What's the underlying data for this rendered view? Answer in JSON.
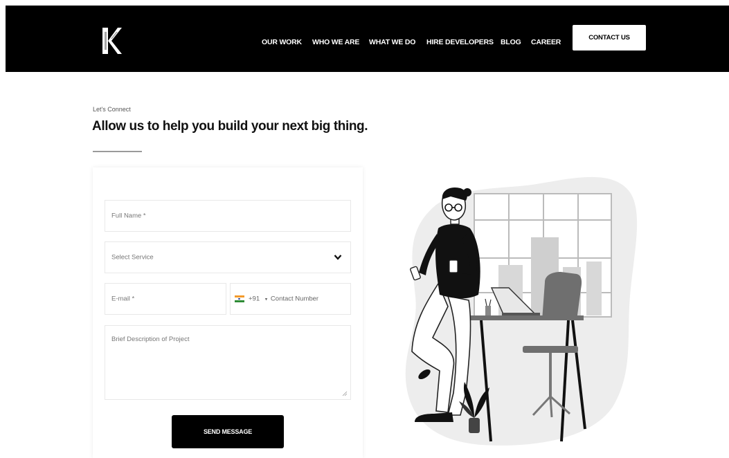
{
  "nav": {
    "items": [
      {
        "label": "OUR WORK"
      },
      {
        "label": "WHO WE ARE"
      },
      {
        "label": "WHAT WE DO"
      },
      {
        "label": "HIRE DEVELOPERS"
      },
      {
        "label": "BLOG"
      },
      {
        "label": "CAREER"
      }
    ],
    "cta_label": "CONTACT US"
  },
  "hero": {
    "eyebrow": "Let's Connect",
    "headline": "Allow us to help you build your next big thing."
  },
  "form": {
    "full_name_placeholder": "Full Name *",
    "service_placeholder": "Select Service",
    "email_placeholder": "E-mail *",
    "country_code": "+91",
    "contact_placeholder": "Contact Number",
    "description_placeholder": "Brief Description of Project",
    "submit_label": "SEND MESSAGE"
  },
  "icons": {
    "logo": "k-logo-icon",
    "dropdown": "chevron-down-icon",
    "flag": "india-flag-icon",
    "illustration": "office-worker-illustration"
  },
  "colors": {
    "header_bg": "#000000",
    "cta_bg": "#ffffff",
    "button_bg": "#000000",
    "flag_saffron": "#f39a2b",
    "flag_green": "#2e8b36"
  }
}
